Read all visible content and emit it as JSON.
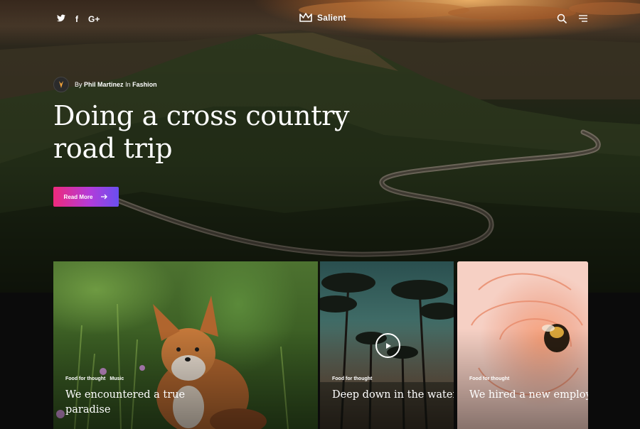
{
  "nav": {
    "social": [
      {
        "name": "twitter",
        "glyph": "🐦"
      },
      {
        "name": "facebook",
        "glyph": "f"
      },
      {
        "name": "google-plus",
        "glyph": "G+"
      }
    ],
    "brand": "Salient",
    "icons": [
      "search-icon",
      "menu-icon"
    ]
  },
  "hero": {
    "by_prefix": "By",
    "author": "Phil Martinez",
    "in_prefix": "In",
    "category": "Fashion",
    "headline": "Doing a cross country road trip",
    "cta": "Read More",
    "accent_start": "#ee2a7b",
    "accent_end": "#6a4ff0"
  },
  "cards": [
    {
      "tags": [
        "Food for thought",
        "Music"
      ],
      "title": "We encountered a true paradise"
    },
    {
      "tags": [
        "Food for thought"
      ],
      "title": "Deep down in the water",
      "icon": "play-icon"
    },
    {
      "tags": [
        "Food for thought"
      ],
      "title": "We hired a new employee"
    }
  ]
}
